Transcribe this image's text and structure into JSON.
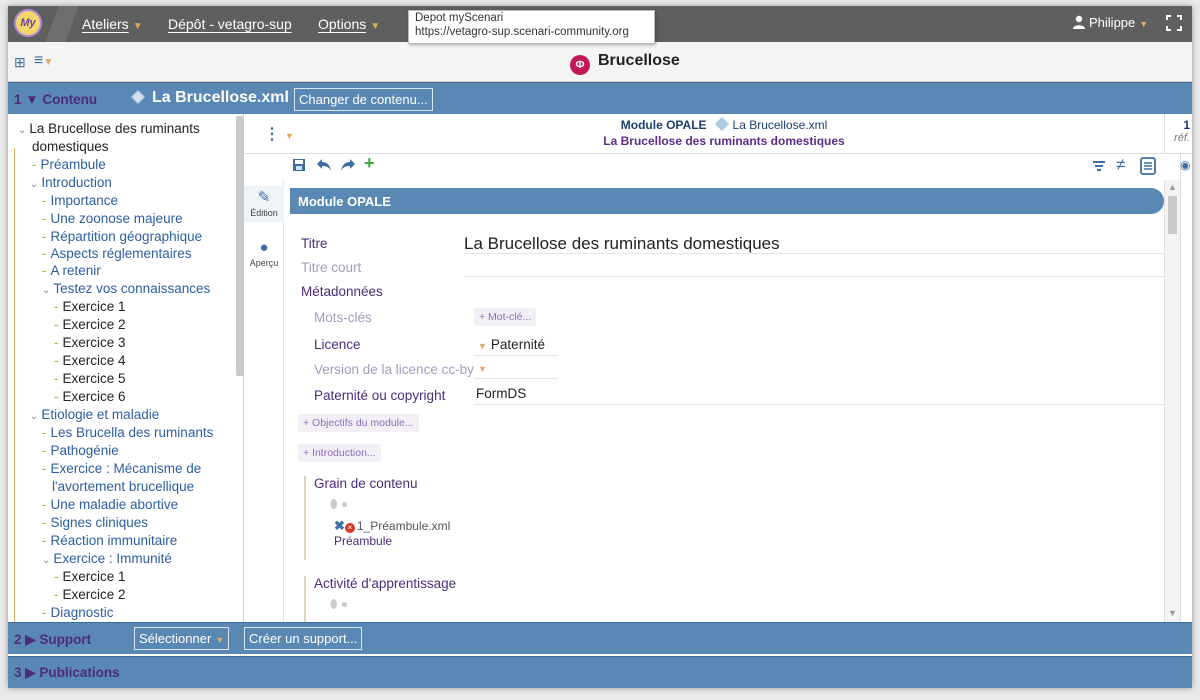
{
  "topbar": {
    "logo_text": "My",
    "menu_ateliers": "Ateliers",
    "menu_depot": "Dépôt - vetagro-sup",
    "menu_options": "Options",
    "tooltip_line1": "Depot myScenari",
    "tooltip_line2": "https://vetagro-sup.scenari-community.org",
    "user": "Philippe"
  },
  "secbar": {
    "title": "Brucellose"
  },
  "section1": {
    "label": "1 ▼ Contenu",
    "file": "La Brucellose.xml",
    "change_button": "Changer de contenu..."
  },
  "section2": {
    "label": "2 ▶ Support",
    "select_button": "Sélectionner",
    "create_button": "Créer un support..."
  },
  "section3": {
    "label": "3 ▶ Publications"
  },
  "tree": {
    "root_line1": "La Brucellose des ruminants",
    "root_line2": "domestiques",
    "items": [
      "Préambule",
      "Introduction",
      "Importance",
      "Une zoonose majeure",
      "Répartition géographique",
      "Aspects réglementaires",
      "A retenir",
      "Testez vos connaissances",
      "Exercice 1",
      "Exercice 2",
      "Exercice 3",
      "Exercice 4",
      "Exercice 5",
      "Exercice 6",
      "Etiologie et maladie",
      "Les Brucella des ruminants",
      "Pathogénie",
      "Exercice : Mécanisme de",
      "l'avortement brucellique",
      "Une maladie abortive",
      "Signes cliniques",
      "Réaction immunitaire",
      "Exercice : Immunité",
      "Exercice 1",
      "Exercice 2",
      "Diagnostic"
    ]
  },
  "editor": {
    "head_title": "Module OPALE",
    "head_file": "La Brucellose.xml",
    "head_subtitle": "La Brucellose des ruminants domestiques",
    "ref_count": "1",
    "ref_label": "réf.",
    "tab_edition": "Édition",
    "tab_apercu": "Aperçu",
    "module_header": "Module OPALE",
    "titre_label": "Titre",
    "titre_value": "La Brucellose des ruminants domestiques",
    "titre_court_label": "Titre court",
    "metadonnees_label": "Métadonnées",
    "mots_cles_label": "Mots-clés",
    "mot_cle_button": "+ Mot-clé...",
    "licence_label": "Licence",
    "licence_value": "Paternité",
    "version_label": "Version de la licence cc-by",
    "paternite_label": "Paternité ou copyright",
    "paternite_value": "FormDS",
    "objectifs_button": "+ Objectifs du module...",
    "introduction_button": "+ Introduction...",
    "grain_label": "Grain de contenu",
    "grain_file": "1_Préambule.xml",
    "grain_sub": "Préambule",
    "activite_label": "Activité d'apprentissage"
  }
}
